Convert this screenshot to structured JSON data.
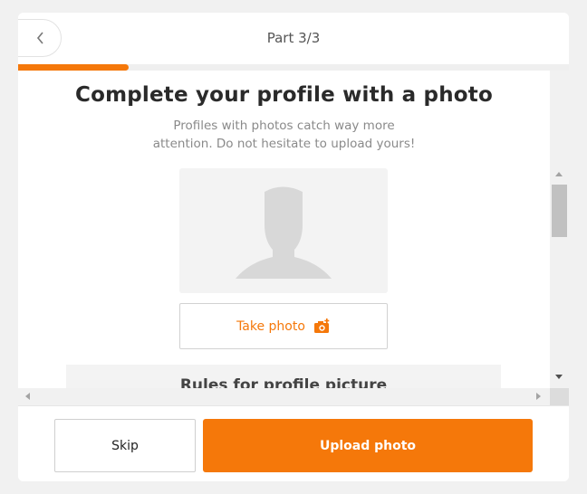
{
  "header": {
    "title": "Part 3/3",
    "progress_fraction": 0.2
  },
  "main": {
    "title": "Complete your profile with a photo",
    "subtitle": "Profiles with photos catch way more attention. Do not hesitate to upload yours!",
    "take_photo_label": "Take photo",
    "rules_title": "Rules for profile picture"
  },
  "footer": {
    "skip_label": "Skip",
    "upload_label": "Upload photo"
  },
  "colors": {
    "accent": "#f5780a",
    "avatar_placeholder": "#d8d8d8"
  },
  "icons": {
    "back": "chevron-left-icon",
    "avatar": "person-silhouette-icon",
    "camera": "camera-add-icon"
  }
}
